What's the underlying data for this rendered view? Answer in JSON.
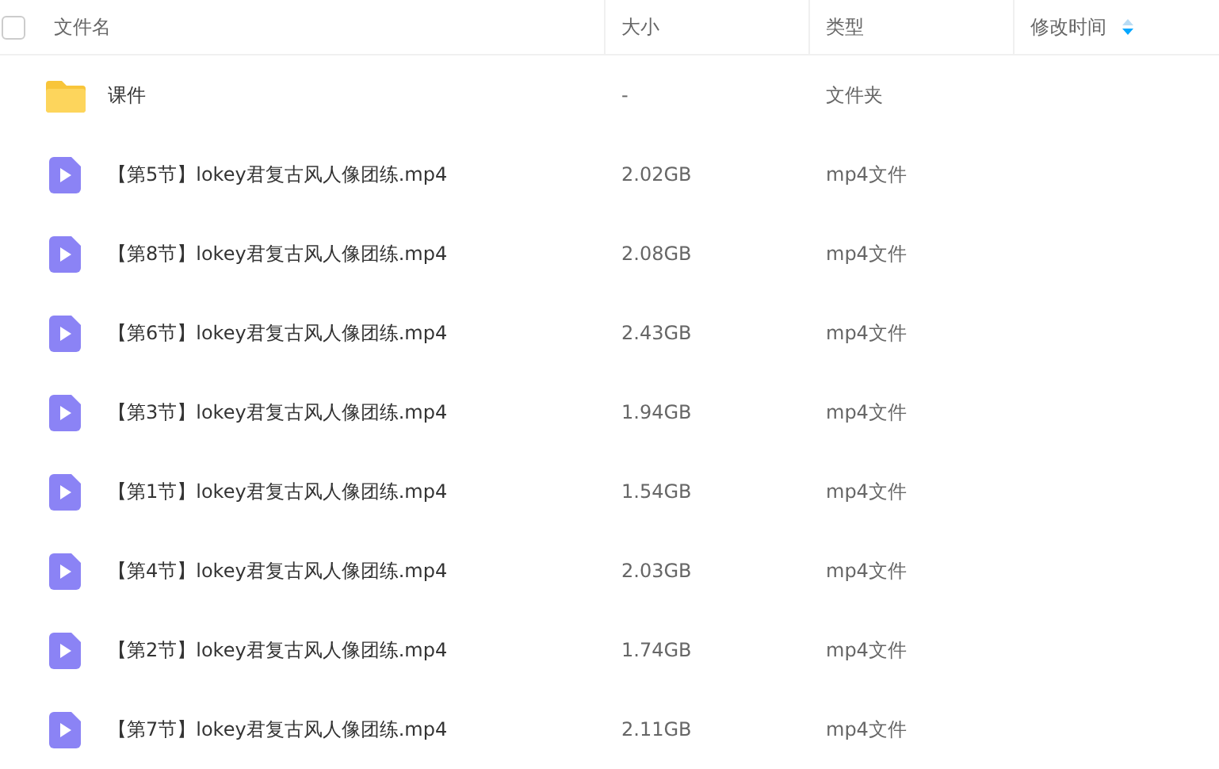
{
  "header": {
    "select_all_checked": false,
    "columns": [
      "文件名",
      "大小",
      "类型",
      "修改时间"
    ]
  },
  "rows": [
    {
      "kind": "folder",
      "name": "课件",
      "size": "-",
      "type": "文件夹"
    },
    {
      "kind": "video",
      "name": "【第5节】lokey君复古风人像团练.mp4",
      "size": "2.02GB",
      "type": "mp4文件"
    },
    {
      "kind": "video",
      "name": "【第8节】lokey君复古风人像团练.mp4",
      "size": "2.08GB",
      "type": "mp4文件"
    },
    {
      "kind": "video",
      "name": "【第6节】lokey君复古风人像团练.mp4",
      "size": "2.43GB",
      "type": "mp4文件"
    },
    {
      "kind": "video",
      "name": "【第3节】lokey君复古风人像团练.mp4",
      "size": "1.94GB",
      "type": "mp4文件"
    },
    {
      "kind": "video",
      "name": "【第1节】lokey君复古风人像团练.mp4",
      "size": "1.54GB",
      "type": "mp4文件"
    },
    {
      "kind": "video",
      "name": "【第4节】lokey君复古风人像团练.mp4",
      "size": "2.03GB",
      "type": "mp4文件"
    },
    {
      "kind": "video",
      "name": "【第2节】lokey君复古风人像团练.mp4",
      "size": "1.74GB",
      "type": "mp4文件"
    },
    {
      "kind": "video",
      "name": "【第7节】lokey君复古风人像团练.mp4",
      "size": "2.11GB",
      "type": "mp4文件"
    }
  ]
}
